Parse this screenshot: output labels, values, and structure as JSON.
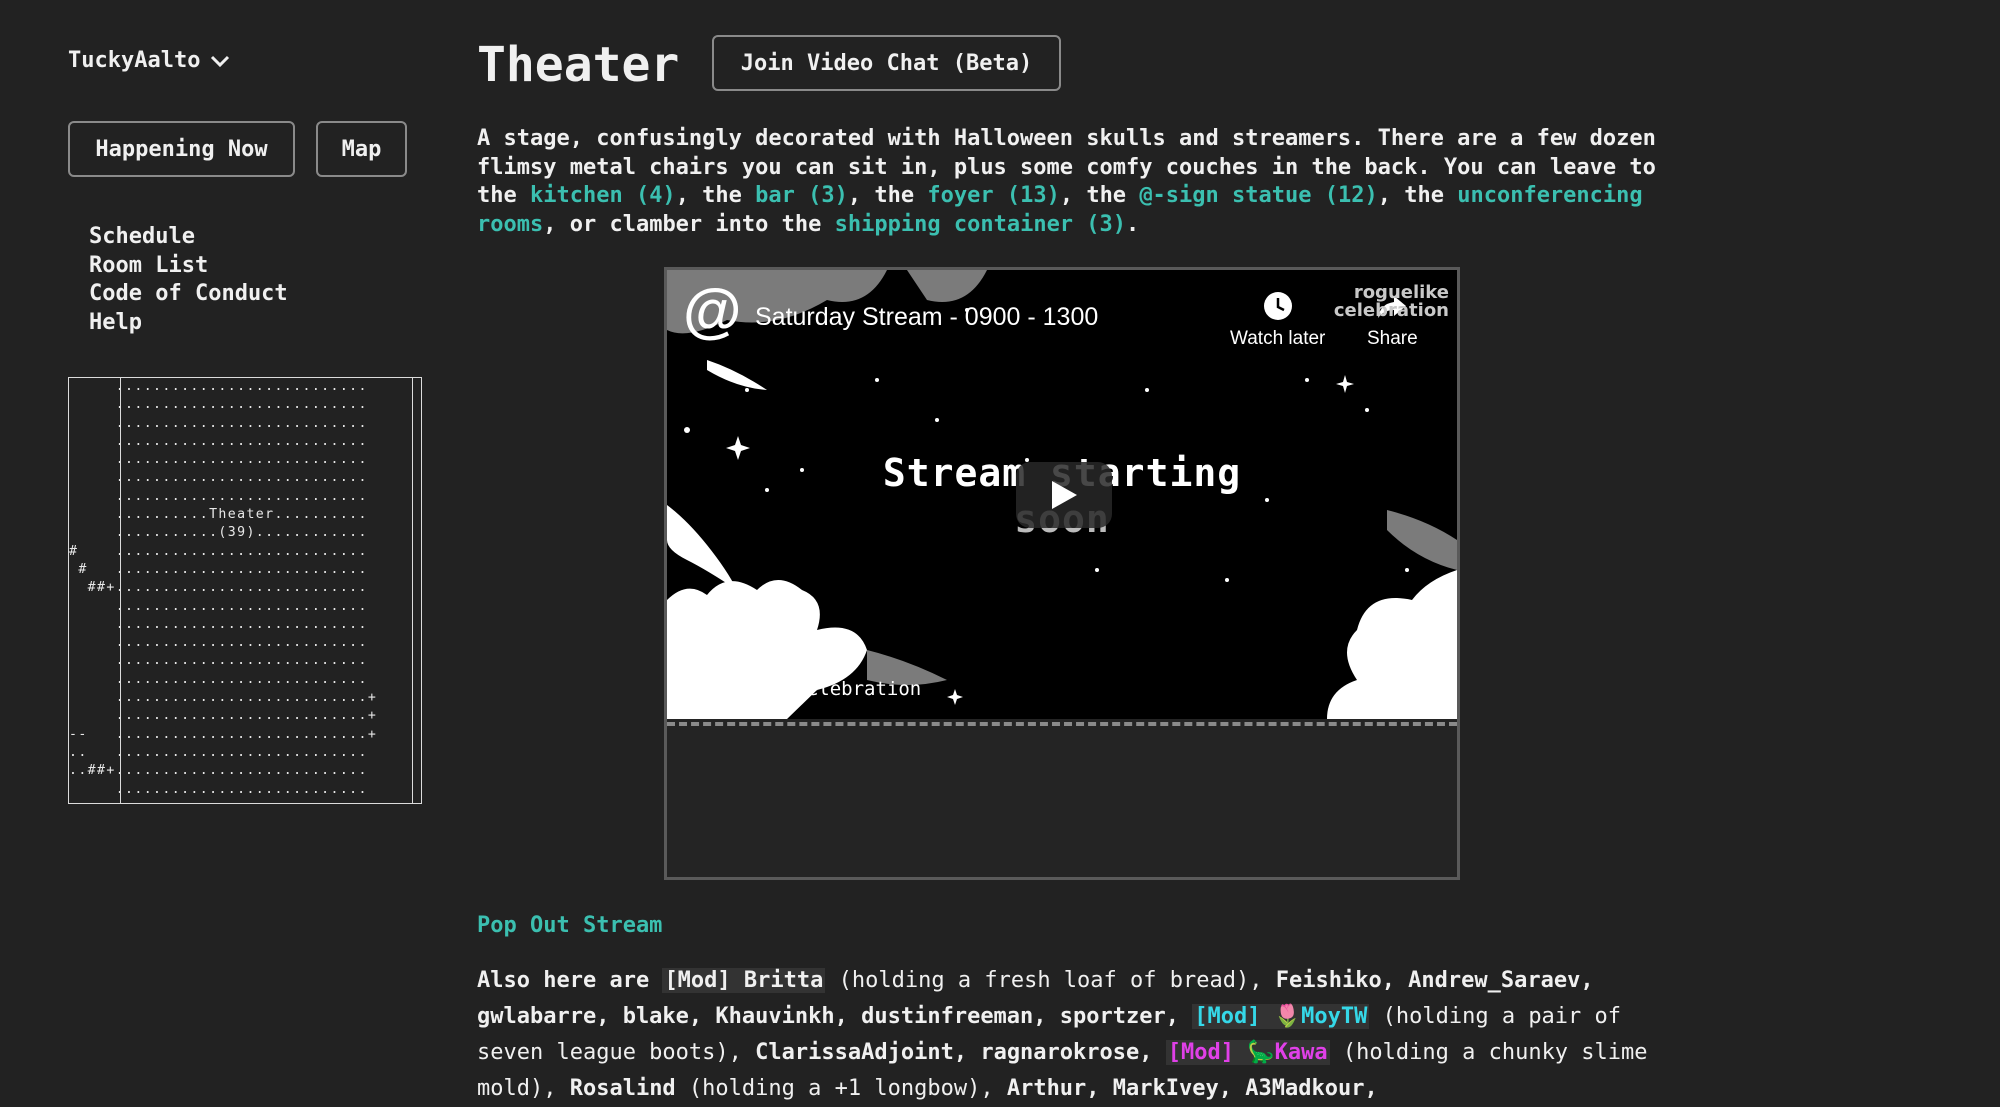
{
  "sidebar": {
    "username": "TuckyAalto",
    "happening_now": "Happening Now",
    "map": "Map",
    "nav": [
      "Schedule",
      "Room List",
      "Code of Conduct",
      "Help"
    ],
    "minimap_label_1": "Theater",
    "minimap_label_2": "(39)"
  },
  "room": {
    "title": "Theater",
    "video_chat_button": "Join Video Chat (Beta)",
    "desc_1": "A stage, confusingly decorated with Halloween skulls and streamers. There are a few dozen flimsy metal chairs you can sit in, plus some comfy couches in the back. You can leave to the ",
    "link_kitchen": "kitchen (4)",
    "sep_the": ", the ",
    "link_bar": "bar (3)",
    "link_foyer": "foyer (13)",
    "link_statue": "@-sign statue (12)",
    "sep_the_end": ", the",
    "link_unconf": "unconferencing rooms",
    "desc_2": ", or clamber into the ",
    "link_container": "shipping container (3)",
    "desc_end": "."
  },
  "video": {
    "title": "Saturday Stream - 0900 - 1300",
    "watch_later": "Watch later",
    "share": "Share",
    "brand_1": "roguelike",
    "brand_2": "celebration",
    "overlay_line1": "Stream starting",
    "overlay_line2": "soon",
    "hashtag": "#RoguelikeCelebration"
  },
  "popout": "Pop Out Stream",
  "presence": {
    "intro": "Also here are ",
    "britta": "[Mod] Britta",
    "britta_hold": " (holding a fresh loaf of bread), ",
    "names_1": "Feishiko, Andrew_Saraev, gwlabarre, blake, Khauvinkh, dustinfreeman, sportzer, ",
    "moy_tag": "[Mod]",
    "moy_name": "MoyTW",
    "moy_hold": " (holding a pair of seven league boots), ",
    "names_2": "ClarissaAdjoint, ragnarokrose, ",
    "kawa_tag": "[Mod]",
    "kawa_name": "Kawa",
    "kawa_hold": " (holding a chunky slime mold), ",
    "rosalind": "Rosalind",
    "rosalind_hold": " (holding a +1 longbow), ",
    "names_3": "Arthur, MarkIvey, A3Madkour,"
  },
  "colors": {
    "background": "#222222",
    "link": "#3bbfb0",
    "mod_cyan": "#35d8e8",
    "mod_pink": "#e040e8"
  }
}
